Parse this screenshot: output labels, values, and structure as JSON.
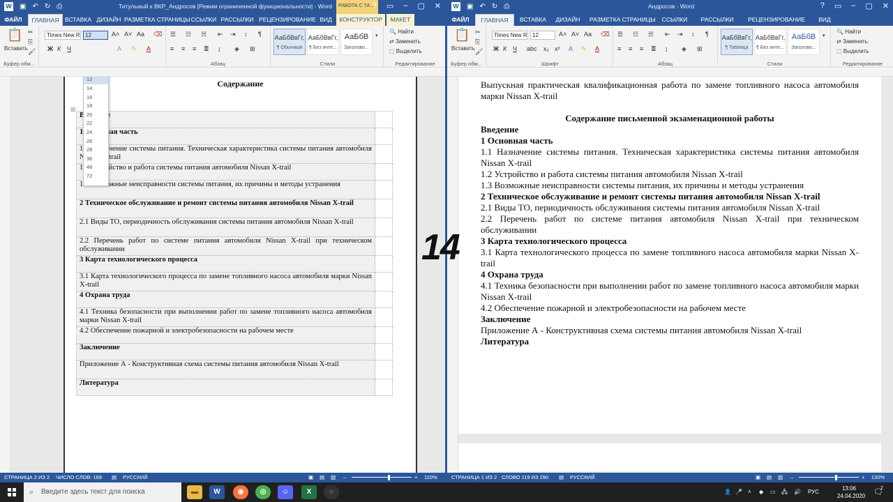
{
  "left_window": {
    "title": "Титульный к ВКР_Андросов [Режим ограниченной функциональности] - Word",
    "context_title": "РАБОТА С ТА...",
    "tabs": [
      "ФАЙЛ",
      "ГЛАВНАЯ",
      "ВСТАВКА",
      "ДИЗАЙН",
      "РАЗМЕТКА СТРАНИЦЫ",
      "ССЫЛКИ",
      "РАССЫЛКИ",
      "РЕЦЕНЗИРОВАНИЕ",
      "ВИД",
      "КОНСТРУКТОР",
      "МАКЕТ"
    ],
    "ribbon": {
      "clipboard_label": "Буфер обм...",
      "paste_label": "Вставить",
      "font_name": "Times New R",
      "font_size": "12",
      "font_group_label": "",
      "paragraph_label": "Абзац",
      "styles_label": "Стили",
      "editing_label": "Редактирование",
      "find": "Найти",
      "replace": "Заменить",
      "select": "Выделить",
      "styles": [
        {
          "preview": "АаБбВвГг,",
          "name": "¶ Обычный"
        },
        {
          "preview": "АаБбВвГг,",
          "name": "¶ Без инте..."
        },
        {
          "preview": "АаБбВ",
          "name": "Заголово..."
        }
      ]
    },
    "font_size_options": [
      "8",
      "9",
      "10",
      "11",
      "12",
      "14",
      "16",
      "18",
      "20",
      "22",
      "24",
      "26",
      "28",
      "36",
      "48",
      "72"
    ],
    "doc": {
      "heading": "Содержание",
      "rows": [
        {
          "text": "Введение",
          "bold": true
        },
        {
          "text": "1 Основная часть",
          "bold": true
        },
        {
          "text": "1.1 Назначение системы питания. Техническая характеристика системы питания автомобиля Nissan X-trail",
          "bold": false
        },
        {
          "text": "1.2 Устройство и работа системы питания автомобиля Nissan X-trail",
          "bold": false
        },
        {
          "text": "1.3 Возможные неисправности системы питания, их причины и методы устранения",
          "bold": false
        },
        {
          "text": "2 Техническое обслуживание и ремонт системы питания автомобиля Nissan X-trail",
          "bold": true
        },
        {
          "text": "2.1 Виды ТО, периодичность обслуживания системы питания автомобиля Nissan X-trail",
          "bold": false
        },
        {
          "text": "2.2 Перечень работ по системе питания автомобиля Nissan X-trail при техническом обслуживании",
          "bold": false
        },
        {
          "text": "3 Карта технологического процесса",
          "bold": true
        },
        {
          "text": "3.1 Карта технологического процесса по замене топливного насоса автомобиля марки Nissan X-trail",
          "bold": false
        },
        {
          "text": "4 Охрана труда",
          "bold": true
        },
        {
          "text": "4.1 Техника безопасности при выполнении работ по замене топливного насоса автомобиля марки Nissan X-trail",
          "bold": false
        },
        {
          "text": "4.2 Обеспечение пожарной и электробезопасности на рабочем месте",
          "bold": false
        },
        {
          "text": "Заключение",
          "bold": true
        },
        {
          "text": "Приложение А - Конструктивная схема системы питания автомобиля Nissan X-trail",
          "bold": false
        },
        {
          "text": "Литература",
          "bold": true
        }
      ]
    },
    "status": {
      "page": "СТРАНИЦА 2 ИЗ 2",
      "words": "ЧИСЛО СЛОВ: 168",
      "lang": "РУССКИЙ",
      "zoom": "110%"
    }
  },
  "right_window": {
    "title": "Андросов - Word",
    "tabs": [
      "ФАЙЛ",
      "ГЛАВНАЯ",
      "ВСТАВКА",
      "ДИЗАЙН",
      "РАЗМЕТКА СТРАНИЦЫ",
      "ССЫЛКИ",
      "РАССЫЛКИ",
      "РЕЦЕНЗИРОВАНИЕ",
      "ВИД"
    ],
    "ribbon": {
      "clipboard_label": "Буфер обм...",
      "paste_label": "Вставить",
      "font_name": "Times New R",
      "font_size": "12",
      "font_label": "Шрифт",
      "paragraph_label": "Абзац",
      "styles_label": "Стили",
      "editing_label": "Редактирование",
      "find": "Найти",
      "replace": "Заменить",
      "select": "Выделить",
      "styles": [
        {
          "preview": "АаБбВвГг,",
          "name": "¶ Таблица"
        },
        {
          "preview": "АаБбВвГг,",
          "name": "¶ Без инте..."
        },
        {
          "preview": "АаБбВ",
          "name": "Заголово..."
        }
      ]
    },
    "doc": {
      "intro": "Выпускная практическая квалификационная работа по замене топливного насоса автомобиля марки Nissan X-trail",
      "heading": "Содержание письменной экзаменационной работы",
      "lines": [
        {
          "text": "Введение",
          "bold": true
        },
        {
          "text": "1 Основная часть",
          "bold": true
        },
        {
          "text": "1.1 Назначение системы питания. Техническая характеристика системы питания автомобиля Nissan X-trail",
          "bold": false
        },
        {
          "text": "1.2 Устройство и работа системы питания автомобиля Nissan X-trail",
          "bold": false
        },
        {
          "text": "1.3 Возможные неисправности системы питания, их причины и методы устранения",
          "bold": false
        },
        {
          "text": "2 Техническое обслуживание и ремонт системы питания автомобиля Nissan X-trail",
          "bold": true
        },
        {
          "text": "2.1 Виды ТО, периодичность обслуживания системы питания автомобиля Nissan X-trail",
          "bold": false
        },
        {
          "text": "2.2 Перечень работ по системе питания автомобиля Nissan X-trail при техническом обслуживании",
          "bold": false
        },
        {
          "text": "3 Карта технологического процесса",
          "bold": true
        },
        {
          "text": "3.1 Карта технологического процесса по замене топливного насоса автомобиля марки Nissan X-trail",
          "bold": false
        },
        {
          "text": "4 Охрана труда",
          "bold": true
        },
        {
          "text": "4.1 Техника безопасности при выполнении работ по замене топливного насоса автомобиля марки Nissan X-trail",
          "bold": false
        },
        {
          "text": "4.2 Обеспечение пожарной и электробезопасности на рабочем месте",
          "bold": false
        },
        {
          "text": "Заключение",
          "bold": true
        },
        {
          "text": "Приложение А - Конструктивная схема системы питания автомобиля Nissan X-trail",
          "bold": false
        },
        {
          "text": "Литература",
          "bold": true
        }
      ]
    },
    "status": {
      "page": "СТРАНИЦА 1 ИЗ 2",
      "words": "СЛОВО 119 ИЗ 290",
      "lang": "РУССКИЙ",
      "zoom": "130%"
    }
  },
  "overlay_number": "14",
  "taskbar": {
    "search_placeholder": "Введите здесь текст для поиска",
    "lang": "РУС",
    "time": "13:06",
    "date": "24.04.2020",
    "notif_count": "2"
  },
  "colors": {
    "word_blue": "#2b579a",
    "context_tab": "#f2d27a",
    "taskbar": "#202020"
  }
}
